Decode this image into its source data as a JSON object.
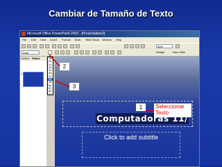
{
  "slide": {
    "title": "Cambiar de Tamaño de Texto"
  },
  "app": {
    "window_title": "Microsoft Office PowerPoint 2003 - [Presentation2]",
    "menu": [
      "File",
      "Edit",
      "View",
      "Insert",
      "Format",
      "Tools",
      "Slide Show",
      "Window",
      "Help"
    ],
    "zoom": "68%",
    "font_name": "Arial",
    "font_size_values": [
      "18",
      "20",
      "24",
      "28",
      "32",
      "36",
      "40",
      "44",
      "48",
      "54",
      "60",
      "66",
      "72"
    ],
    "design_label": "Design",
    "new_slide_label": "New Slide",
    "tabs": [
      "Outline",
      "Slides"
    ],
    "thumb_number": "1",
    "slide_main_text": "Computadoras 11/",
    "subtitle_placeholder": "Click to add subtitle"
  },
  "callouts": {
    "step1": "1",
    "step2": "2",
    "step3": "3",
    "step1_label": "Seleccionar Texto"
  },
  "colors": {
    "accent_red": "#d00000",
    "slide_blue": "#1534a0"
  }
}
